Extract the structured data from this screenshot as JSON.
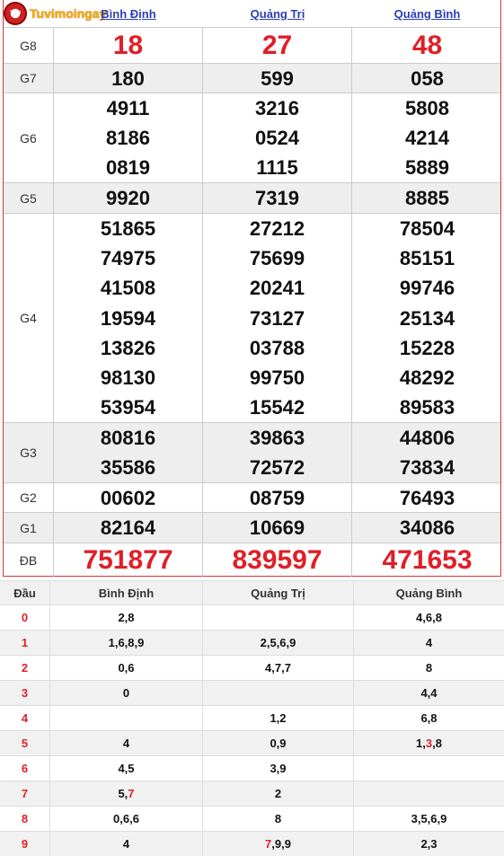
{
  "logo_text": "Tuvimoingay",
  "logo_badge": "TVN",
  "provinces": [
    "Bình Định",
    "Quảng Trị",
    "Quảng Bình"
  ],
  "prizes": [
    {
      "label": "G8",
      "values": [
        [
          "18"
        ],
        [
          "27"
        ],
        [
          "48"
        ]
      ]
    },
    {
      "label": "G7",
      "values": [
        [
          "180"
        ],
        [
          "599"
        ],
        [
          "058"
        ]
      ]
    },
    {
      "label": "G6",
      "values": [
        [
          "4911",
          "8186",
          "0819"
        ],
        [
          "3216",
          "0524",
          "1115"
        ],
        [
          "5808",
          "4214",
          "5889"
        ]
      ]
    },
    {
      "label": "G5",
      "values": [
        [
          "9920"
        ],
        [
          "7319"
        ],
        [
          "8885"
        ]
      ]
    },
    {
      "label": "G4",
      "values": [
        [
          "51865",
          "74975",
          "41508",
          "19594",
          "13826",
          "98130",
          "53954"
        ],
        [
          "27212",
          "75699",
          "20241",
          "73127",
          "03788",
          "99750",
          "15542"
        ],
        [
          "78504",
          "85151",
          "99746",
          "25134",
          "15228",
          "48292",
          "89583"
        ]
      ]
    },
    {
      "label": "G3",
      "values": [
        [
          "80816",
          "35586"
        ],
        [
          "39863",
          "72572"
        ],
        [
          "44806",
          "73834"
        ]
      ]
    },
    {
      "label": "G2",
      "values": [
        [
          "00602"
        ],
        [
          "08759"
        ],
        [
          "76493"
        ]
      ]
    },
    {
      "label": "G1",
      "values": [
        [
          "82164"
        ],
        [
          "10669"
        ],
        [
          "34086"
        ]
      ]
    },
    {
      "label": "ĐB",
      "values": [
        [
          "751877"
        ],
        [
          "839597"
        ],
        [
          "471653"
        ]
      ]
    }
  ],
  "dau_table": {
    "header": [
      "Đầu",
      "Bình Định",
      "Quảng Trị",
      "Quảng Bình"
    ],
    "rows": [
      {
        "digit": "0",
        "cols": [
          [
            {
              "t": "2,8"
            }
          ],
          [],
          [
            {
              "t": "4,6,8"
            }
          ]
        ]
      },
      {
        "digit": "1",
        "cols": [
          [
            {
              "t": "1,6,8,9"
            }
          ],
          [
            {
              "t": "2,5,6,9"
            }
          ],
          [
            {
              "t": "4"
            }
          ]
        ]
      },
      {
        "digit": "2",
        "cols": [
          [
            {
              "t": "0,6"
            }
          ],
          [
            {
              "t": "4,7,7"
            }
          ],
          [
            {
              "t": "8"
            }
          ]
        ]
      },
      {
        "digit": "3",
        "cols": [
          [
            {
              "t": "0"
            }
          ],
          [],
          [
            {
              "t": "4,4"
            }
          ]
        ]
      },
      {
        "digit": "4",
        "cols": [
          [],
          [
            {
              "t": "1,2"
            }
          ],
          [
            {
              "t": "6,8"
            }
          ]
        ]
      },
      {
        "digit": "5",
        "cols": [
          [
            {
              "t": "4"
            }
          ],
          [
            {
              "t": "0,9"
            }
          ],
          [
            {
              "t": "1,"
            },
            {
              "t": "3",
              "red": true
            },
            {
              "t": ",8"
            }
          ]
        ]
      },
      {
        "digit": "6",
        "cols": [
          [
            {
              "t": "4,5"
            }
          ],
          [
            {
              "t": "3,9"
            }
          ],
          []
        ]
      },
      {
        "digit": "7",
        "cols": [
          [
            {
              "t": "5,"
            },
            {
              "t": "7",
              "red": true
            }
          ],
          [
            {
              "t": "2"
            }
          ],
          []
        ]
      },
      {
        "digit": "8",
        "cols": [
          [
            {
              "t": "0,6,6"
            }
          ],
          [
            {
              "t": "8"
            }
          ],
          [
            {
              "t": "3,5,6,9"
            }
          ]
        ]
      },
      {
        "digit": "9",
        "cols": [
          [
            {
              "t": "4"
            }
          ],
          [
            {
              "t": "7",
              "red": true
            },
            {
              "t": ",9,9"
            }
          ],
          [
            {
              "t": "2,3"
            }
          ]
        ]
      }
    ]
  }
}
